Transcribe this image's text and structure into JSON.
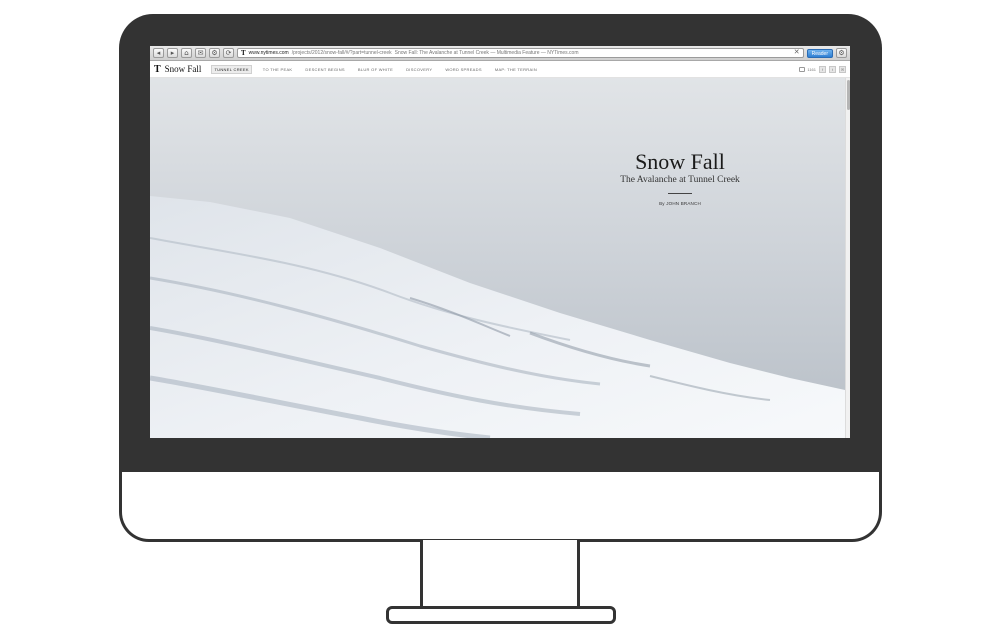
{
  "browser": {
    "url_domain": "www.nytimes.com",
    "url_path": "/projects/2012/snow-fall/#/?part=tunnel-creek",
    "page_title": "Snow Fall: The Avalanche at Tunnel Creek — Multimedia Feature — NYTimes.com",
    "reader_label": "Reader",
    "nav_glyphs": [
      "◂",
      "▸",
      "⌂",
      "✉",
      "⚙",
      "⟳"
    ]
  },
  "site": {
    "logo": "T",
    "title": "Snow Fall",
    "chapters": [
      {
        "label": "Tunnel Creek",
        "active": true
      },
      {
        "label": "To the Peak",
        "active": false
      },
      {
        "label": "Descent Begins",
        "active": false
      },
      {
        "label": "Blur of White",
        "active": false
      },
      {
        "label": "Discovery",
        "active": false
      },
      {
        "label": "Word Spreads",
        "active": false
      },
      {
        "label": "Map: The Terrain",
        "active": false
      }
    ],
    "comment_count": "1161"
  },
  "hero": {
    "headline": "Snow Fall",
    "subhead": "The Avalanche at Tunnel Creek",
    "byline": "By JOHN BRANCH"
  },
  "colors": {
    "bezel": "#333333",
    "sky": "#cfd3d8",
    "snow": "#eef1f4"
  }
}
